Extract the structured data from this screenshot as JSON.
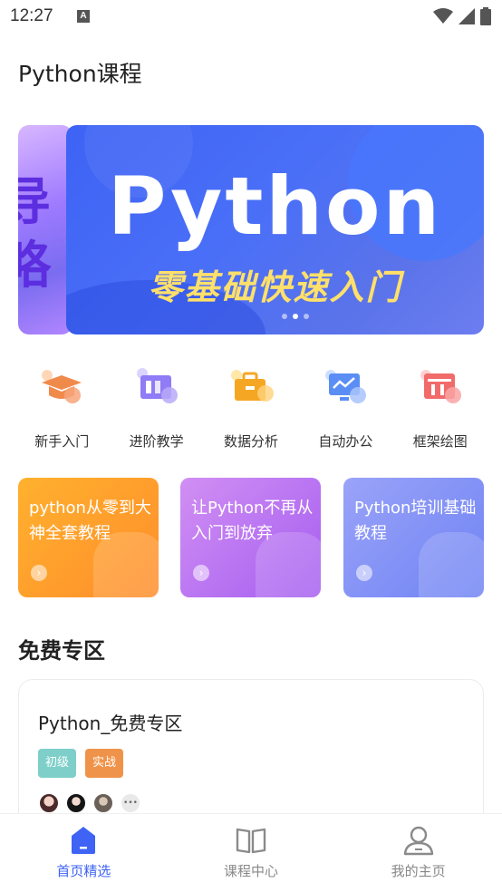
{
  "status_bar": {
    "time": "12:27",
    "notification_badge": "A"
  },
  "page_title": "Python课程",
  "banner": {
    "headline": "Python",
    "subtitle": "零基础快速入门",
    "peek_text": "导略",
    "slide_count": 3,
    "active_slide": 2
  },
  "categories": [
    {
      "label": "新手入门",
      "icon": "graduation-cap-icon",
      "color": "#f08a4b"
    },
    {
      "label": "进阶教学",
      "icon": "book-icon",
      "color": "#8f7cf6"
    },
    {
      "label": "数据分析",
      "icon": "briefcase-icon",
      "color": "#f5a623"
    },
    {
      "label": "自动办公",
      "icon": "monitor-icon",
      "color": "#5b8ef5"
    },
    {
      "label": "框架绘图",
      "icon": "window-icon",
      "color": "#f26b6b"
    }
  ],
  "course_cards": [
    {
      "text": "python从零到大神全套教程",
      "colors": [
        "#ffaa2c",
        "#ff8a2c"
      ]
    },
    {
      "text": "让Python不再从入门到放弃",
      "colors": [
        "#c98af2",
        "#a45df0"
      ]
    },
    {
      "text": "Python培训基础教程",
      "colors": [
        "#8f9bf7",
        "#6f82f4"
      ]
    }
  ],
  "free_section": {
    "title": "免费专区",
    "card_title": "Python_免费专区",
    "tags": [
      {
        "label": "初级",
        "color": "#7ecfc9"
      },
      {
        "label": "实战",
        "color": "#f0934a"
      }
    ],
    "more_label": "•••"
  },
  "tabs": [
    {
      "label": "首页精选",
      "icon": "home-icon",
      "active": true
    },
    {
      "label": "课程中心",
      "icon": "open-book-icon",
      "active": false
    },
    {
      "label": "我的主页",
      "icon": "user-icon",
      "active": false
    }
  ],
  "accent_color": "#3e63f5"
}
